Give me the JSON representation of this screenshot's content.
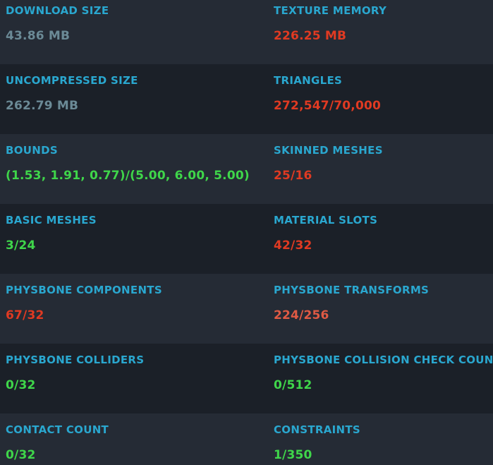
{
  "colors": {
    "label": "#2aa7cf",
    "neutral": "#6b8a96",
    "bad": "#e03a22",
    "warn": "#e05a44",
    "good": "#3fd64a",
    "row_light": "#252b35",
    "row_dark": "#1b2028"
  },
  "stats": {
    "download_size": {
      "label": "DOWNLOAD SIZE",
      "value": "43.86 MB",
      "status": "neutral"
    },
    "texture_memory": {
      "label": "TEXTURE MEMORY",
      "value": "226.25 MB",
      "status": "bad"
    },
    "uncompressed_size": {
      "label": "UNCOMPRESSED SIZE",
      "value": "262.79 MB",
      "status": "neutral"
    },
    "triangles": {
      "label": "TRIANGLES",
      "value": "272,547/70,000",
      "status": "bad"
    },
    "bounds": {
      "label": "BOUNDS",
      "value": "(1.53, 1.91, 0.77)/(5.00, 6.00, 5.00)",
      "status": "good"
    },
    "skinned_meshes": {
      "label": "SKINNED MESHES",
      "value": "25/16",
      "status": "bad"
    },
    "basic_meshes": {
      "label": "BASIC MESHES",
      "value": "3/24",
      "status": "good"
    },
    "material_slots": {
      "label": "MATERIAL SLOTS",
      "value": "42/32",
      "status": "bad"
    },
    "physbone_components": {
      "label": "PHYSBONE COMPONENTS",
      "value": "67/32",
      "status": "bad"
    },
    "physbone_transforms": {
      "label": "PHYSBONE TRANSFORMS",
      "value": "224/256",
      "status": "warn"
    },
    "physbone_colliders": {
      "label": "PHYSBONE COLLIDERS",
      "value": "0/32",
      "status": "good"
    },
    "physbone_collision_check_count": {
      "label": "PHYSBONE COLLISION CHECK COUNT",
      "value": "0/512",
      "status": "good"
    },
    "contact_count": {
      "label": "CONTACT COUNT",
      "value": "0/32",
      "status": "good"
    },
    "constraints": {
      "label": "CONSTRAINTS",
      "value": "1/350",
      "status": "good"
    }
  }
}
